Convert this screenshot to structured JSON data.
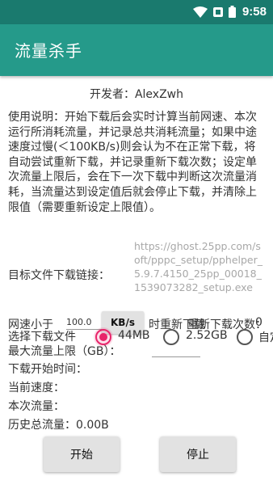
{
  "status_bar": {
    "time": "9:58"
  },
  "app": {
    "title": "流量杀手"
  },
  "developer": "开发者：AlexZwh",
  "instructions": "使用说明：开始下载后会实时计算当前网速、本次运行所消耗流量，并记录总共消耗流量；如果中途速度过慢(＜100KB/s)则会认为不在正常下载，将自动尝试重新下载，并记录重新下载次数；设定单次流量上限后，会在下一次下载中判断这次流量消耗，当流量达到设定值后就会停止下载，并清除上限值（需要重新设定上限值）。",
  "target_url": {
    "label": "目标文件下载链接：",
    "value": "https://ghost.25pp.com/soft/pppc_setup/pphelper_5.9.7.4150_25pp_00018_1539073282_setup.exe"
  },
  "speed_row": {
    "prefix": "网速小于",
    "input_value": "100.0",
    "unit_button": "KB/s",
    "suffix": "时重新下载",
    "redownload_label": "重新下载次数：",
    "redownload_count": "0"
  },
  "file_select": {
    "label": "选择下载文件",
    "options": [
      {
        "label": "44MB",
        "checked": true
      },
      {
        "label": "2.52GB",
        "checked": false
      },
      {
        "label": "自定义",
        "checked": false
      }
    ]
  },
  "max_limit": {
    "label": "最大流量上限（GB）：",
    "value": ""
  },
  "stats": {
    "start_time_label": "下载开始时间：",
    "current_speed_label": "当前速度：",
    "session_traffic_label": "本次流量：",
    "total_traffic_label": "历史总流量：0.00B"
  },
  "buttons": {
    "start": "开始",
    "stop": "停止"
  },
  "colors": {
    "status_bar": "#1a7a6e",
    "app_bar": "#259a8a",
    "radio_accent": "#e8246a"
  },
  "icons": [
    "wifi-icon",
    "battery-icon",
    "notification-icon"
  ]
}
